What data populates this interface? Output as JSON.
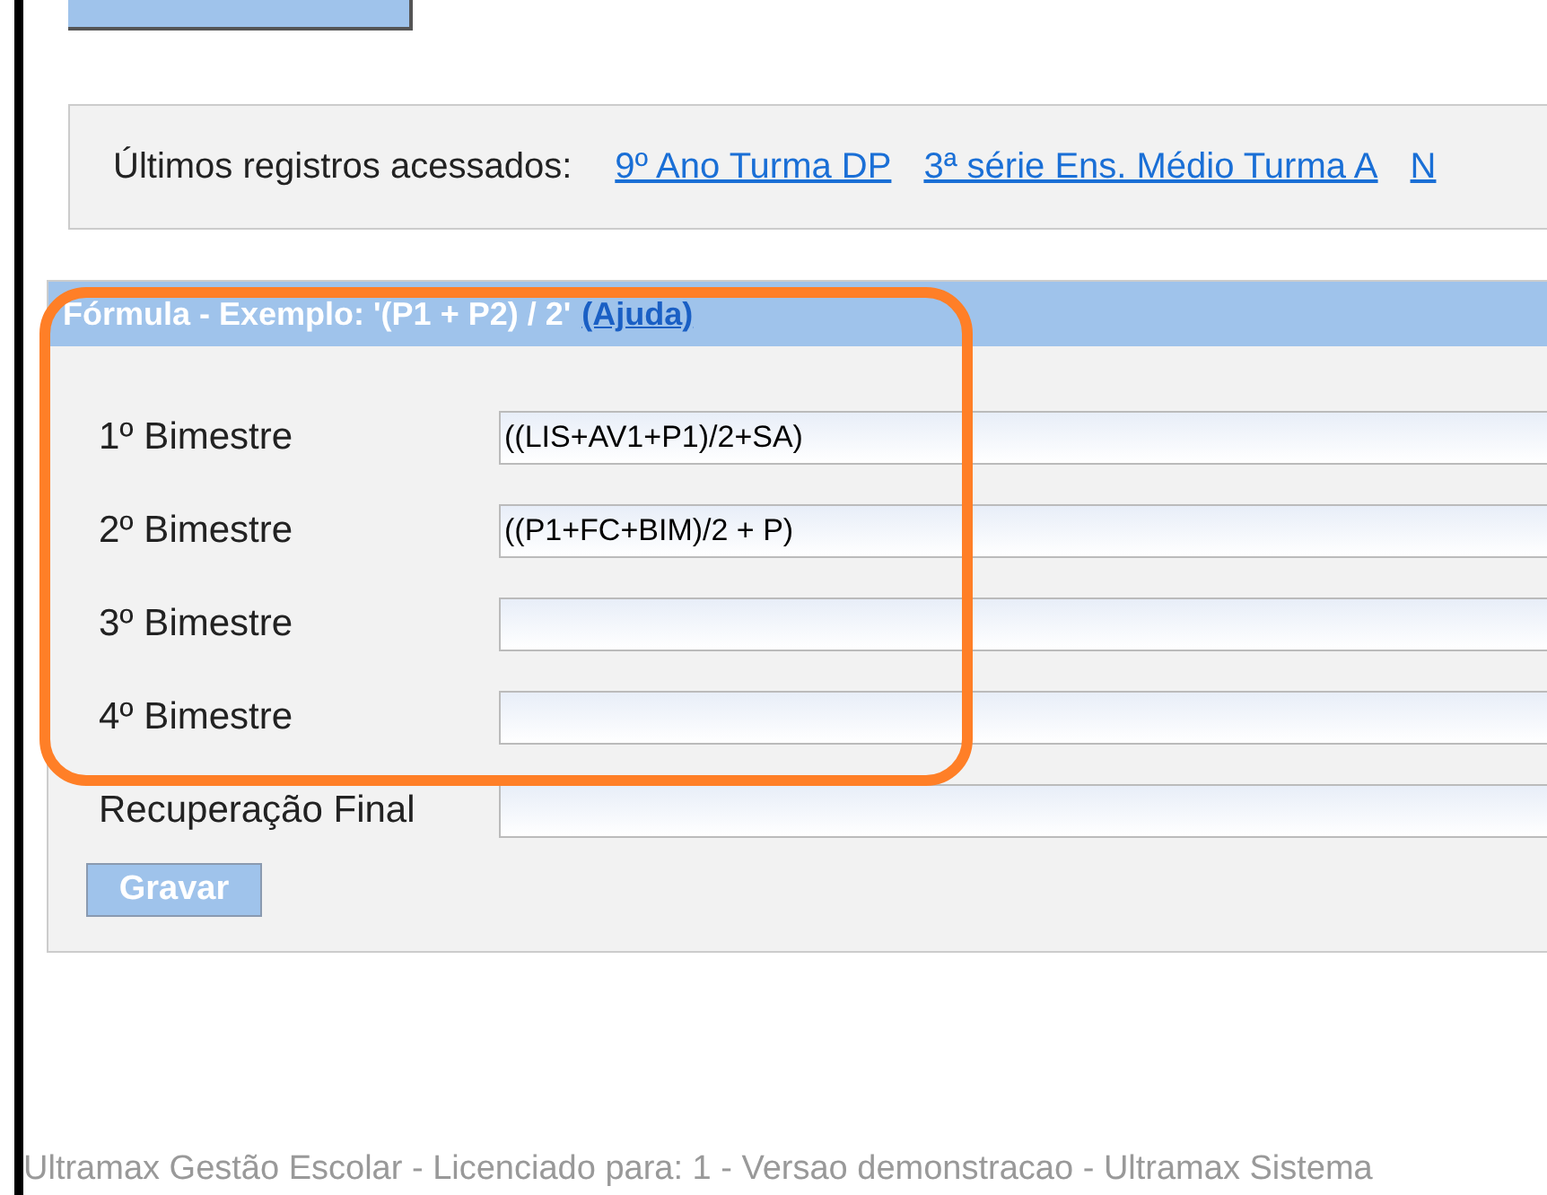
{
  "recent": {
    "label": "Últimos registros acessados:",
    "links": [
      "9º Ano Turma DP",
      "3ª série Ens. Médio Turma A",
      "N"
    ]
  },
  "panel": {
    "header": "Fórmula - Exemplo: '(P1 + P2) / 2'",
    "help_link": "(Ajuda)",
    "fields": [
      {
        "label": "1º Bimestre",
        "value": "((LIS+AV1+P1)/2+SA)"
      },
      {
        "label": "2º Bimestre",
        "value": "((P1+FC+BIM)/2 + P)"
      },
      {
        "label": "3º Bimestre"
      },
      {
        "label": "4º Bimestre"
      },
      {
        "label": "Recuperação Final"
      }
    ],
    "save_button": "Gravar"
  },
  "footer": "Ultramax Gestão Escolar - Licenciado para: 1 - Versao demonstracao - Ultramax Sistema"
}
